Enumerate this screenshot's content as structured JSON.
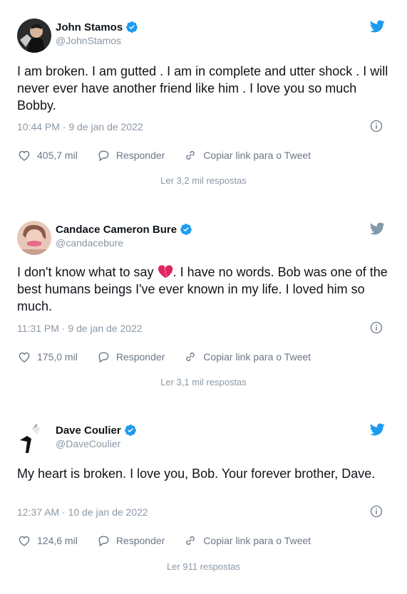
{
  "colors": {
    "brand": "#1d9bf0",
    "text": "#0f1419",
    "muted": "#8b98a5",
    "heart": "#e0245e",
    "badge_gray": "#829aab"
  },
  "tweets": [
    {
      "name": "John Stamos",
      "handle": "@JohnStamos",
      "text": "I am broken. I am gutted . I am in complete and utter shock . I will never ever have another friend like him . I love you so much Bobby.",
      "timestamp": "10:44 PM · 9 de jan de 2022",
      "likes": "405,7 mil",
      "reply_label": "Responder",
      "copy_label": "Copiar link para o Tweet",
      "replies_link": "Ler 3,2 mil respostas"
    },
    {
      "name": "Candace Cameron Bure",
      "handle": "@candacebure",
      "text_before": "I don't know what to say",
      "text_after": ". I have no words. Bob was one of the best humans beings I've ever known in my life. I loved him so much.",
      "timestamp": "11:31 PM · 9 de jan de 2022",
      "likes": "175,0 mil",
      "reply_label": "Responder",
      "copy_label": "Copiar link para o Tweet",
      "replies_link": "Ler 3,1 mil respostas"
    },
    {
      "name": "Dave Coulier",
      "handle": "@DaveCoulier",
      "text": "My heart is broken. I love you, Bob. Your forever brother, Dave.",
      "timestamp": "12:37 AM · 10 de jan de 2022",
      "likes": "124,6 mil",
      "reply_label": "Responder",
      "copy_label": "Copiar link para o Tweet",
      "replies_link": "Ler 911 respostas"
    }
  ]
}
